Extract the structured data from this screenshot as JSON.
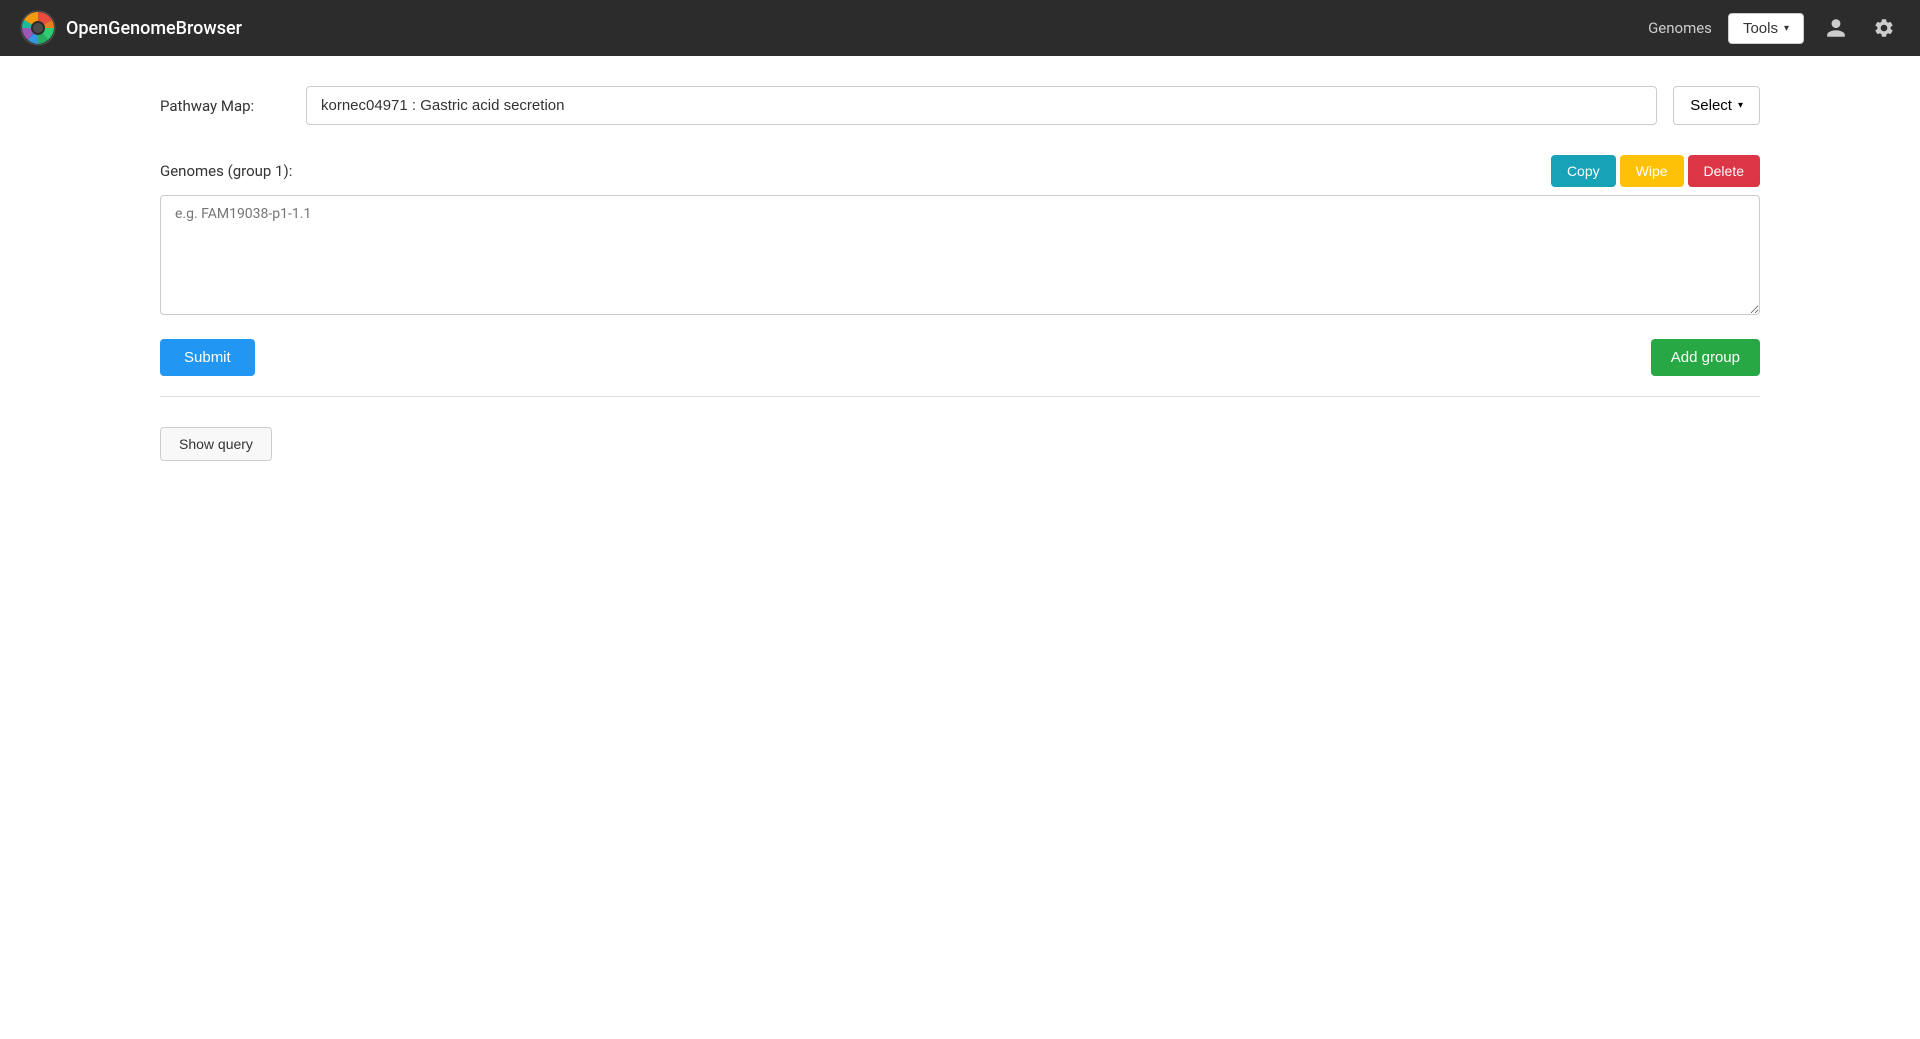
{
  "app": {
    "title": "OpenGenomeBrowser"
  },
  "navbar": {
    "genomes_label": "Genomes",
    "tools_label": "Tools",
    "tools_caret": "▾"
  },
  "pathway": {
    "label": "Pathway Map:",
    "value": "kornec04971 : Gastric acid secretion",
    "select_label": "Select",
    "select_caret": "▾"
  },
  "genomes": {
    "label": "Genomes (group 1):",
    "placeholder": "e.g. FAM19038-p1-1.1",
    "copy_label": "Copy",
    "wipe_label": "Wipe",
    "delete_label": "Delete"
  },
  "actions": {
    "submit_label": "Submit",
    "add_group_label": "Add group",
    "show_query_label": "Show query"
  }
}
